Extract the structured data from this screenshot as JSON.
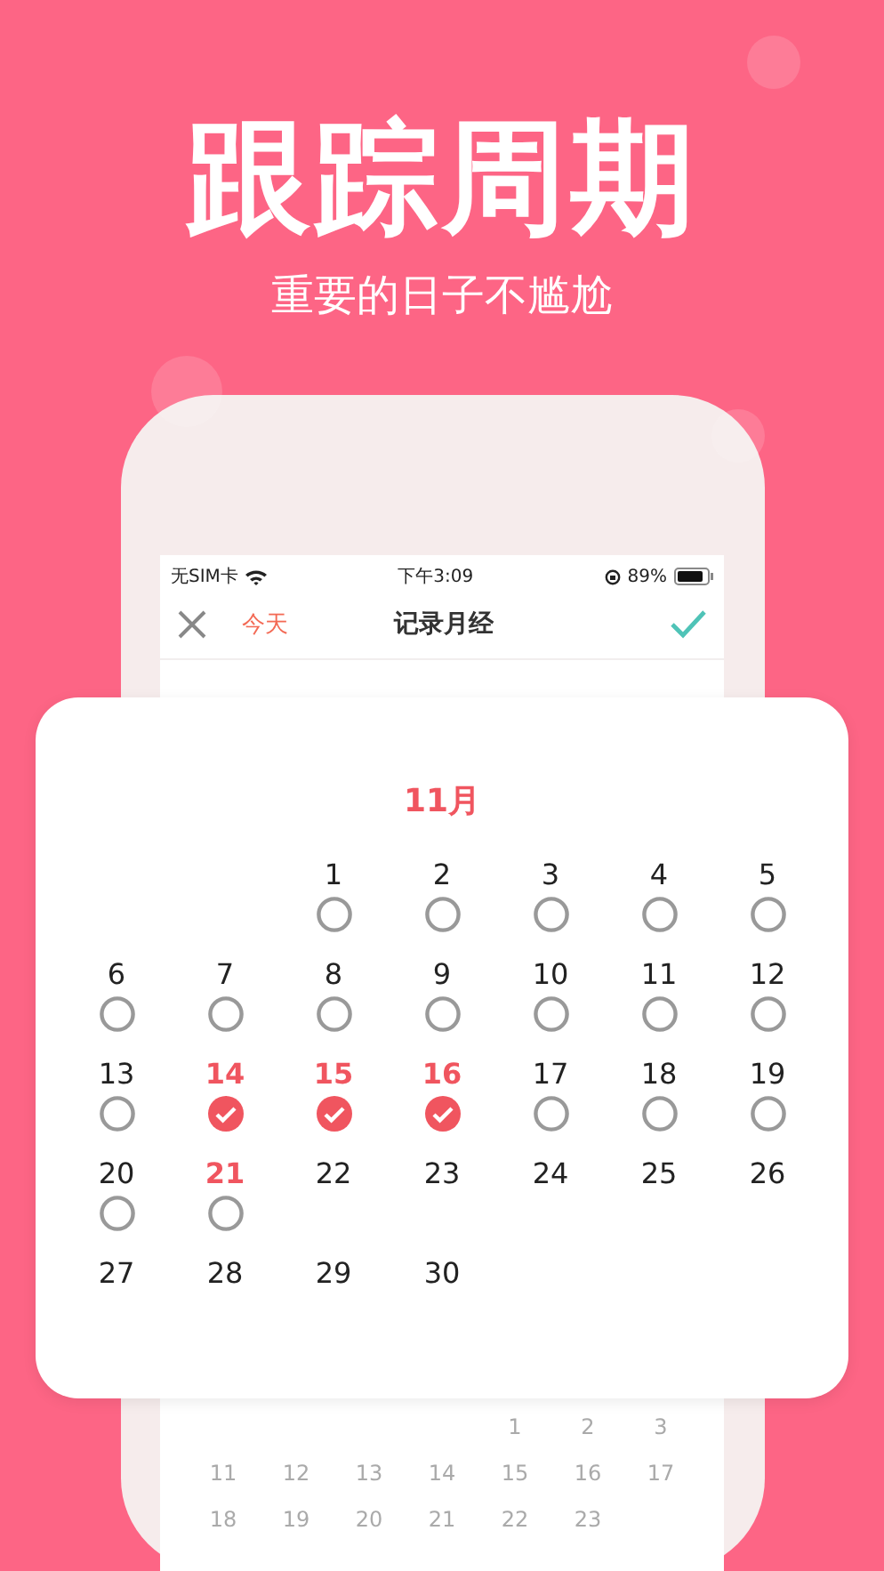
{
  "headline": "跟踪周期",
  "subtitle": "重要的日子不尴尬",
  "status_bar": {
    "carrier": "无SIM卡",
    "time": "下午3:09",
    "battery": "89%"
  },
  "nav": {
    "today": "今天",
    "title": "记录月经"
  },
  "calendar": {
    "month": "11月",
    "days": [
      {
        "day": "1",
        "highlighted": false,
        "checked": false
      },
      {
        "day": "2",
        "highlighted": false,
        "checked": false
      },
      {
        "day": "3",
        "highlighted": false,
        "checked": false
      },
      {
        "day": "4",
        "highlighted": false,
        "checked": false
      },
      {
        "day": "5",
        "highlighted": false,
        "checked": false
      },
      {
        "day": "6",
        "highlighted": false,
        "checked": false
      },
      {
        "day": "7",
        "highlighted": false,
        "checked": false
      },
      {
        "day": "8",
        "highlighted": false,
        "checked": false
      },
      {
        "day": "9",
        "highlighted": false,
        "checked": false
      },
      {
        "day": "10",
        "highlighted": false,
        "checked": false
      },
      {
        "day": "11",
        "highlighted": false,
        "checked": false
      },
      {
        "day": "12",
        "highlighted": false,
        "checked": false
      },
      {
        "day": "13",
        "highlighted": false,
        "checked": false
      },
      {
        "day": "14",
        "highlighted": true,
        "checked": true
      },
      {
        "day": "15",
        "highlighted": true,
        "checked": true
      },
      {
        "day": "16",
        "highlighted": true,
        "checked": true
      },
      {
        "day": "17",
        "highlighted": false,
        "checked": false
      },
      {
        "day": "18",
        "highlighted": false,
        "checked": false
      },
      {
        "day": "19",
        "highlighted": false,
        "checked": false
      },
      {
        "day": "20",
        "highlighted": false,
        "checked": false
      },
      {
        "day": "21",
        "highlighted": true,
        "checked": false
      },
      {
        "day": "22",
        "highlighted": false
      },
      {
        "day": "23",
        "highlighted": false
      },
      {
        "day": "24",
        "highlighted": false
      },
      {
        "day": "25",
        "highlighted": false
      },
      {
        "day": "26",
        "highlighted": false
      },
      {
        "day": "27",
        "highlighted": false
      },
      {
        "day": "28",
        "highlighted": false
      },
      {
        "day": "29",
        "highlighted": false
      },
      {
        "day": "30",
        "highlighted": false
      }
    ]
  },
  "background_calendar": {
    "rows": [
      [
        "",
        "",
        "",
        "",
        "1",
        "2",
        "3"
      ],
      [
        "11",
        "12",
        "13",
        "14",
        "15",
        "16",
        "17"
      ],
      [
        "18",
        "19",
        "20",
        "21",
        "22",
        "23",
        ""
      ]
    ]
  }
}
